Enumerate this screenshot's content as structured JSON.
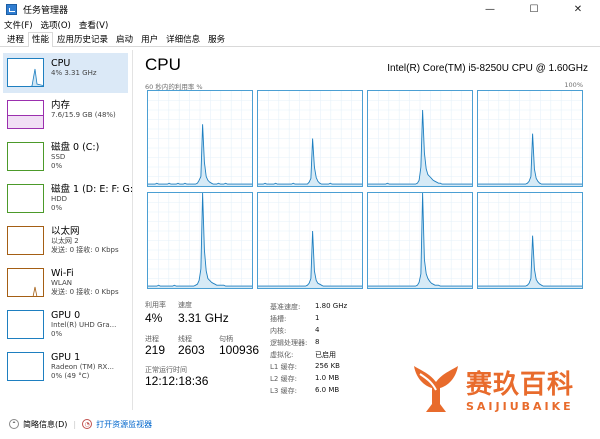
{
  "window": {
    "title": "任务管理器",
    "min": "—",
    "max": "☐",
    "close": "✕"
  },
  "menu": [
    "文件(F)",
    "选项(O)",
    "查看(V)"
  ],
  "tabs": [
    "进程",
    "性能",
    "应用历史记录",
    "启动",
    "用户",
    "详细信息",
    "服务"
  ],
  "sidebar": [
    {
      "title": "CPU",
      "sub1": "4% 3.31 GHz",
      "sub2": "",
      "color": "#1e7fc0"
    },
    {
      "title": "内存",
      "sub1": "7.6/15.9 GB (48%)",
      "sub2": "",
      "color": "#9b2fae"
    },
    {
      "title": "磁盘 0 (C:)",
      "sub1": "SSD",
      "sub2": "0%",
      "color": "#4c9a2a"
    },
    {
      "title": "磁盘 1 (D: E: F: G:",
      "sub1": "HDD",
      "sub2": "0%",
      "color": "#4c9a2a"
    },
    {
      "title": "以太网",
      "sub1": "以太网 2",
      "sub2": "发送: 0 接收: 0 Kbps",
      "color": "#a45e14"
    },
    {
      "title": "Wi-Fi",
      "sub1": "WLAN",
      "sub2": "发送: 0 接收: 0 Kbps",
      "color": "#a45e14"
    },
    {
      "title": "GPU 0",
      "sub1": "Intel(R) UHD Gra...",
      "sub2": "0%",
      "color": "#1e7fc0"
    },
    {
      "title": "GPU 1",
      "sub1": "Radeon (TM) RX...",
      "sub2": "0% (49 °C)",
      "color": "#1e7fc0"
    }
  ],
  "main": {
    "title": "CPU",
    "model": "Intel(R) Core(TM) i5-8250U CPU @ 1.60GHz",
    "graph_left": "60 秒内的利用率 %",
    "graph_right": "100%"
  },
  "core_usage": [
    [
      2,
      2,
      2,
      2,
      2,
      3,
      2,
      2,
      2,
      2,
      2,
      2,
      3,
      2,
      2,
      2,
      2,
      3,
      2,
      2,
      2,
      3,
      2,
      2,
      2,
      2,
      2,
      2,
      3,
      6,
      10,
      65,
      25,
      10,
      6,
      4,
      3,
      2,
      2,
      2,
      3,
      2,
      2,
      2,
      3,
      2,
      2,
      2,
      2,
      2,
      2,
      2,
      2,
      2,
      2,
      2,
      2,
      2,
      2,
      2
    ],
    [
      2,
      2,
      2,
      2,
      3,
      2,
      2,
      2,
      2,
      2,
      3,
      2,
      2,
      2,
      2,
      2,
      2,
      2,
      2,
      2,
      3,
      2,
      2,
      2,
      2,
      2,
      2,
      2,
      2,
      4,
      8,
      50,
      20,
      9,
      5,
      3,
      2,
      2,
      2,
      2,
      2,
      3,
      2,
      2,
      2,
      2,
      2,
      2,
      2,
      2,
      2,
      2,
      2,
      2,
      2,
      2,
      2,
      2,
      2,
      2
    ],
    [
      2,
      2,
      2,
      2,
      2,
      2,
      2,
      2,
      2,
      2,
      2,
      3,
      2,
      2,
      2,
      2,
      2,
      2,
      2,
      2,
      2,
      2,
      2,
      2,
      2,
      2,
      2,
      2,
      3,
      6,
      20,
      80,
      35,
      18,
      12,
      10,
      8,
      6,
      5,
      4,
      3,
      3,
      2,
      2,
      2,
      2,
      2,
      2,
      2,
      2,
      2,
      2,
      2,
      2,
      2,
      2,
      2,
      2,
      2,
      2
    ],
    [
      2,
      2,
      2,
      2,
      2,
      2,
      2,
      2,
      2,
      2,
      2,
      2,
      2,
      2,
      2,
      2,
      2,
      2,
      2,
      2,
      2,
      2,
      2,
      2,
      2,
      2,
      2,
      2,
      3,
      5,
      10,
      55,
      18,
      8,
      5,
      3,
      2,
      2,
      2,
      2,
      2,
      2,
      2,
      2,
      2,
      2,
      2,
      2,
      2,
      2,
      2,
      2,
      2,
      2,
      2,
      2,
      2,
      2,
      2,
      2
    ],
    [
      2,
      2,
      2,
      2,
      2,
      2,
      3,
      2,
      2,
      2,
      2,
      2,
      2,
      2,
      2,
      3,
      2,
      2,
      2,
      2,
      2,
      2,
      2,
      2,
      2,
      2,
      2,
      3,
      4,
      8,
      20,
      100,
      40,
      18,
      10,
      8,
      6,
      5,
      4,
      3,
      3,
      3,
      3,
      3,
      2,
      2,
      2,
      2,
      2,
      2,
      2,
      2,
      2,
      2,
      2,
      2,
      2,
      2,
      2,
      2
    ],
    [
      2,
      2,
      2,
      2,
      2,
      2,
      2,
      2,
      2,
      2,
      2,
      2,
      2,
      2,
      2,
      2,
      2,
      2,
      2,
      2,
      2,
      2,
      2,
      2,
      2,
      2,
      2,
      2,
      3,
      5,
      10,
      60,
      18,
      8,
      5,
      4,
      3,
      2,
      2,
      2,
      2,
      2,
      2,
      2,
      2,
      2,
      2,
      2,
      2,
      2,
      2,
      2,
      2,
      2,
      2,
      2,
      2,
      2,
      2,
      2
    ],
    [
      2,
      2,
      2,
      2,
      2,
      2,
      2,
      2,
      2,
      2,
      2,
      2,
      2,
      2,
      2,
      2,
      2,
      2,
      2,
      2,
      2,
      2,
      2,
      2,
      2,
      2,
      2,
      2,
      3,
      6,
      15,
      100,
      30,
      15,
      10,
      7,
      5,
      4,
      3,
      3,
      3,
      2,
      2,
      2,
      2,
      2,
      2,
      2,
      2,
      2,
      2,
      2,
      2,
      2,
      2,
      2,
      2,
      2,
      2,
      2
    ],
    [
      2,
      2,
      2,
      2,
      2,
      2,
      2,
      2,
      2,
      2,
      2,
      2,
      2,
      2,
      2,
      2,
      2,
      2,
      2,
      2,
      2,
      2,
      2,
      2,
      2,
      2,
      2,
      2,
      3,
      5,
      10,
      55,
      20,
      9,
      6,
      4,
      3,
      2,
      2,
      2,
      2,
      2,
      2,
      2,
      2,
      2,
      2,
      2,
      2,
      2,
      2,
      2,
      2,
      2,
      2,
      2,
      2,
      2,
      2,
      2
    ]
  ],
  "stats": {
    "util_label": "利用率",
    "util": "4%",
    "speed_label": "速度",
    "speed": "3.31 GHz",
    "proc_label": "进程",
    "proc": "219",
    "threads_label": "线程",
    "threads": "2603",
    "handles_label": "句柄",
    "handles": "100936",
    "uptime_label": "正常运行时间",
    "uptime": "12:12:18:36",
    "kv": [
      {
        "k": "基准速度:",
        "v": "1.80 GHz"
      },
      {
        "k": "插槽:",
        "v": "1"
      },
      {
        "k": "内核:",
        "v": "4"
      },
      {
        "k": "逻辑处理器:",
        "v": "8"
      },
      {
        "k": "虚拟化:",
        "v": "已启用"
      },
      {
        "k": "L1 缓存:",
        "v": "256 KB"
      },
      {
        "k": "L2 缓存:",
        "v": "1.0 MB"
      },
      {
        "k": "L3 缓存:",
        "v": "6.0 MB"
      }
    ]
  },
  "footer": {
    "less": "简略信息(D)",
    "monitor": "打开资源监视器"
  },
  "watermark": {
    "cn": "赛玖百科",
    "en": "SAIJIUBAIKE"
  }
}
